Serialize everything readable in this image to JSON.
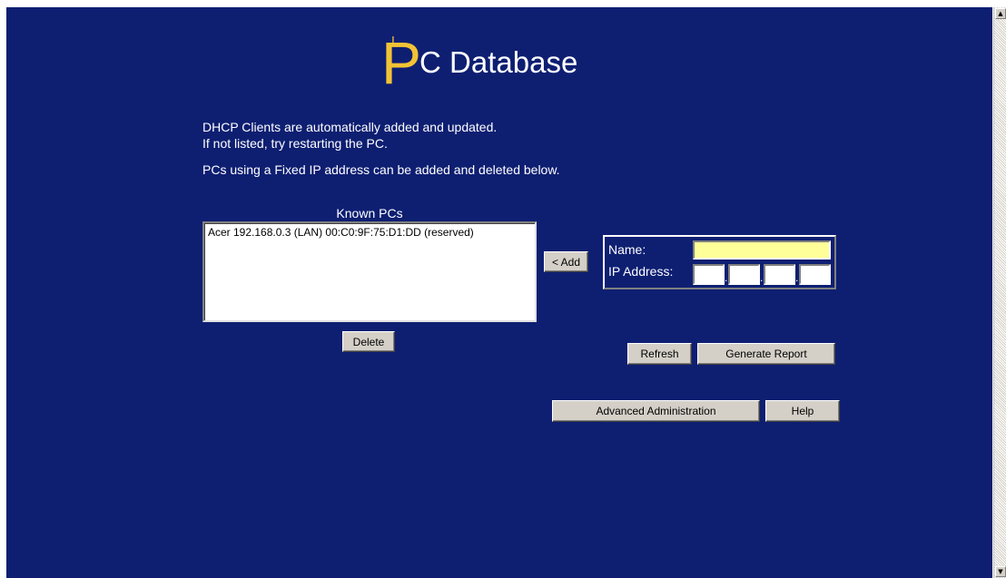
{
  "header": {
    "title_first_letter": "P",
    "title_rest": "C Database",
    "cursor_glyph": "I"
  },
  "description": {
    "line1": "DHCP Clients are automatically added and updated.",
    "line2": "If not listed, try restarting the PC.",
    "line3": "PCs using a Fixed IP address can be added and deleted below."
  },
  "known_pcs": {
    "label": "Known PCs",
    "items": [
      "Acer 192.168.0.3 (LAN) 00:C0:9F:75:D1:DD (reserved)"
    ],
    "delete_label": "Delete"
  },
  "entry": {
    "add_label": "< Add",
    "name_label": "Name:",
    "name_value": "",
    "ip_label": "IP Address:",
    "ip_octets": [
      "",
      "",
      "",
      ""
    ],
    "ip_separator": "."
  },
  "actions": {
    "refresh_label": "Refresh",
    "report_label": "Generate Report",
    "advanced_label": "Advanced Administration",
    "help_label": "Help"
  },
  "colors": {
    "background": "#0e1f72",
    "accent": "#f2c334",
    "name_field": "#ffff99",
    "button_face": "#d4d0c8"
  },
  "scrollbar": {
    "up_arrow": "▲",
    "down_arrow": "▼"
  }
}
